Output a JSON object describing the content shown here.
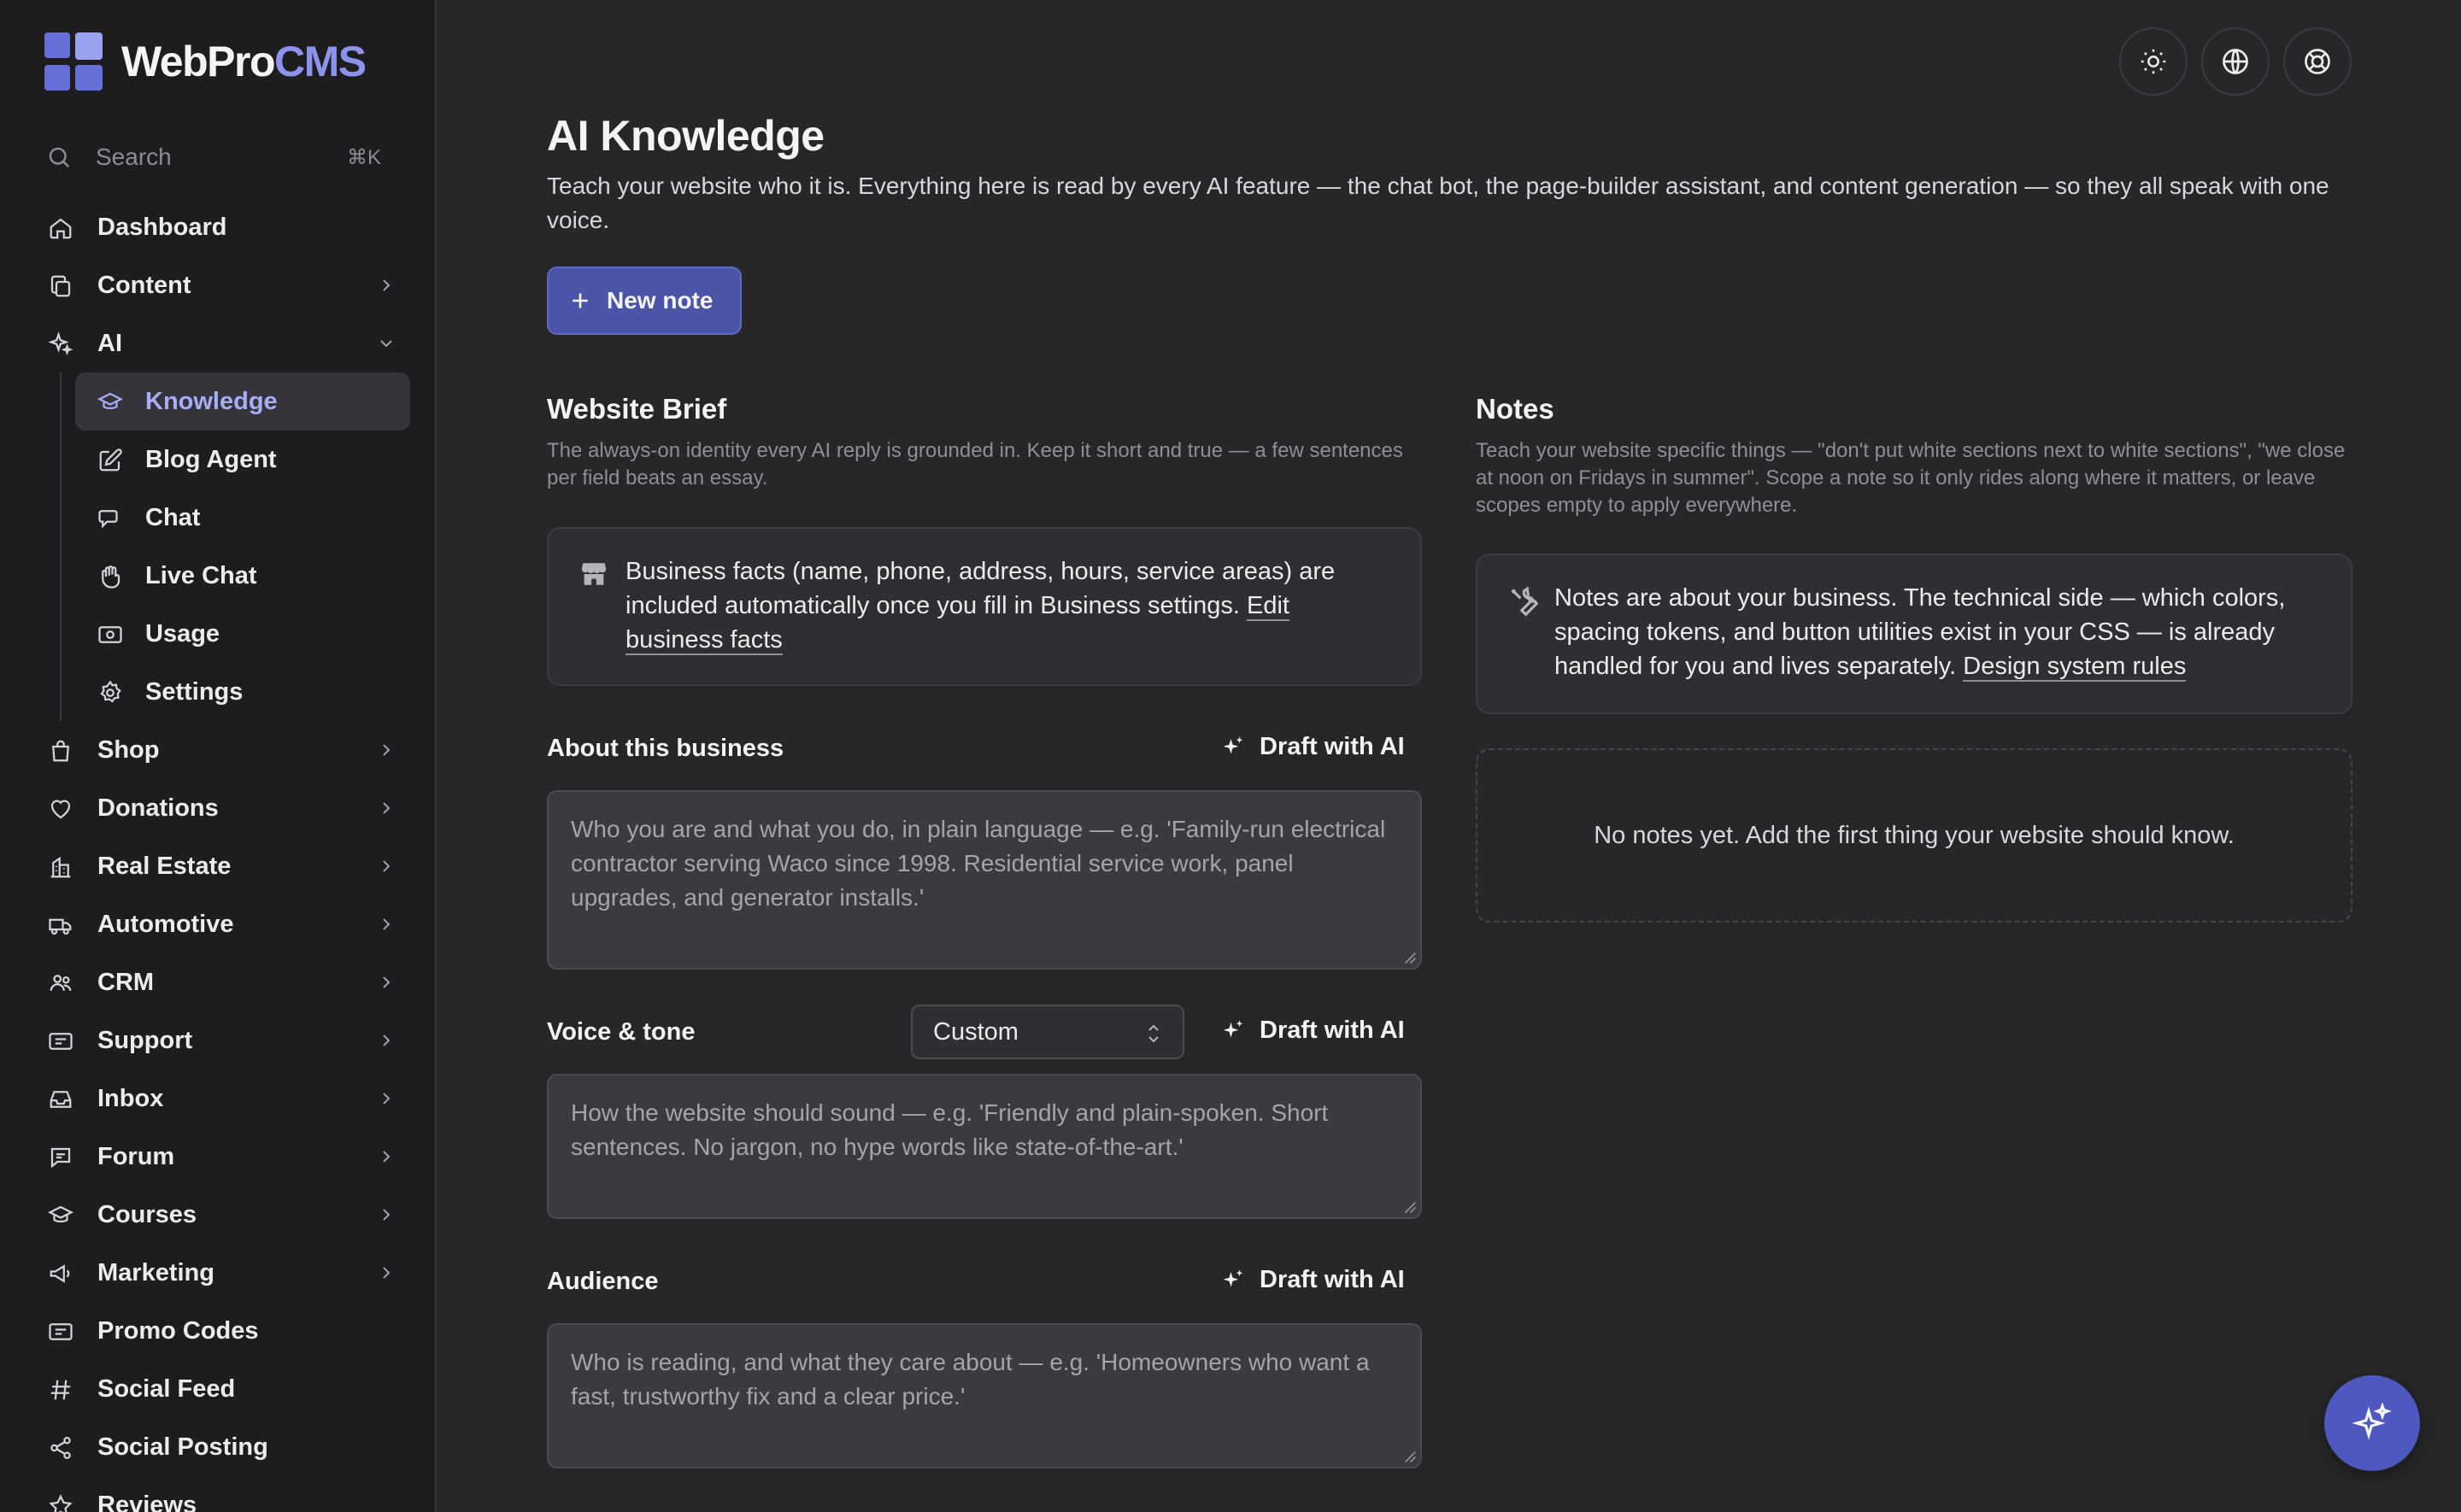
{
  "brand": {
    "name_main": "WebPro",
    "name_accent": "CMS"
  },
  "search": {
    "placeholder": "Search",
    "shortcut": "⌘K"
  },
  "sidebar": {
    "items": [
      {
        "label": "Dashboard",
        "icon": "home-icon"
      },
      {
        "label": "Content",
        "icon": "copy-icon",
        "expandable": true
      },
      {
        "label": "AI",
        "icon": "sparkles-icon",
        "expanded": true,
        "children": [
          {
            "label": "Knowledge",
            "icon": "graduation-cap-icon",
            "active": true
          },
          {
            "label": "Blog Agent",
            "icon": "pencil-square-icon"
          },
          {
            "label": "Chat",
            "icon": "chat-bubbles-icon"
          },
          {
            "label": "Live Chat",
            "icon": "hand-icon"
          },
          {
            "label": "Usage",
            "icon": "banknote-icon"
          },
          {
            "label": "Settings",
            "icon": "gear-icon"
          }
        ]
      },
      {
        "label": "Shop",
        "icon": "shopping-bag-icon",
        "expandable": true
      },
      {
        "label": "Donations",
        "icon": "heart-icon",
        "expandable": true
      },
      {
        "label": "Real Estate",
        "icon": "building-icon",
        "expandable": true
      },
      {
        "label": "Automotive",
        "icon": "truck-icon",
        "expandable": true
      },
      {
        "label": "CRM",
        "icon": "users-icon",
        "expandable": true
      },
      {
        "label": "Support",
        "icon": "ticket-icon",
        "expandable": true
      },
      {
        "label": "Inbox",
        "icon": "inbox-icon",
        "expandable": true
      },
      {
        "label": "Forum",
        "icon": "chat-bubble-icon",
        "expandable": true
      },
      {
        "label": "Courses",
        "icon": "graduation-cap-icon",
        "expandable": true
      },
      {
        "label": "Marketing",
        "icon": "megaphone-icon",
        "expandable": true
      },
      {
        "label": "Promo Codes",
        "icon": "ticket-icon"
      },
      {
        "label": "Social Feed",
        "icon": "hashtag-icon"
      },
      {
        "label": "Social Posting",
        "icon": "share-icon"
      },
      {
        "label": "Reviews",
        "icon": "star-icon"
      }
    ]
  },
  "topbar": {
    "icons": [
      "sun-icon",
      "globe-icon",
      "lifebuoy-icon"
    ]
  },
  "page": {
    "title": "AI Knowledge",
    "description": "Teach your website who it is. Everything here is read by every AI feature — the chat bot, the page-builder assistant, and content generation — so they all speak with one voice.",
    "new_note_label": "New note"
  },
  "brief": {
    "title": "Website Brief",
    "subtitle": "The always-on identity every AI reply is grounded in. Keep it short and true — a few sentences per field beats an essay.",
    "info_text": "Business facts (name, phone, address, hours, service areas) are included automatically once you fill in Business settings.",
    "info_link": "Edit business facts",
    "draft_label": "Draft with AI",
    "about": {
      "label": "About this business",
      "placeholder": "Who you are and what you do, in plain language — e.g. 'Family-run electrical contractor serving Waco since 1998. Residential service work, panel upgrades, and generator installs.'"
    },
    "voice": {
      "label": "Voice & tone",
      "select_value": "Custom",
      "placeholder": "How the website should sound — e.g. 'Friendly and plain-spoken. Short sentences. No jargon, no hype words like state-of-the-art.'"
    },
    "audience": {
      "label": "Audience",
      "placeholder": "Who is reading, and what they care about — e.g. 'Homeowners who want a fast, trustworthy fix and a clear price.'"
    }
  },
  "notes": {
    "title": "Notes",
    "subtitle": "Teach your website specific things — \"don't put white sections next to white sections\", \"we close at noon on Fridays in summer\". Scope a note so it only rides along where it matters, or leave scopes empty to apply everywhere.",
    "info_text": "Notes are about your business. The technical side — which colors, spacing tokens, and button utilities exist in your CSS — is already handled for you and lives separately.",
    "info_link": "Design system rules",
    "empty": "No notes yet. Add the first thing your website should know."
  },
  "colors": {
    "accent": "#4c54a8",
    "accent_text": "#a8aef4",
    "background": "#27272a",
    "sidebar": "#1d1d20"
  }
}
